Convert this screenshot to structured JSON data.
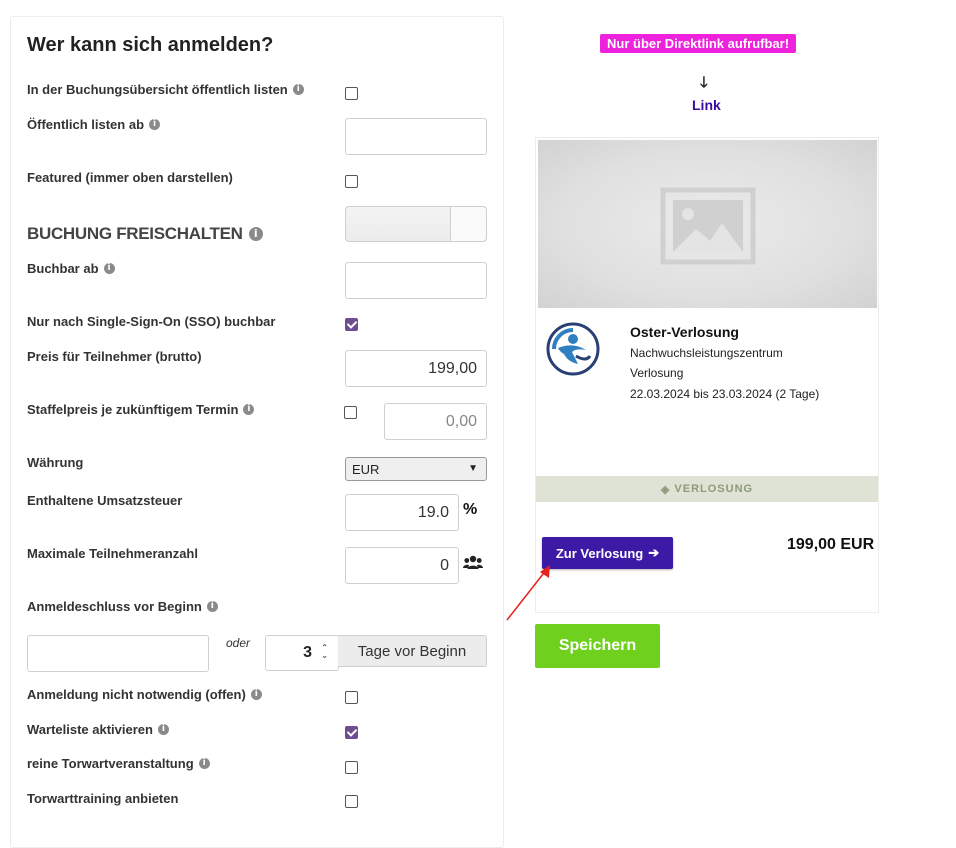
{
  "form": {
    "title": "Wer kann sich anmelden?",
    "list_public_label": "In der Buchungsübersicht öffentlich listen",
    "list_public_from_label": "Öffentlich listen ab",
    "featured_label": "Featured (immer oben darstellen)",
    "section_booking": "BUCHUNG FREISCHALTEN",
    "bookable_from_label": "Buchbar ab",
    "sso_label": "Nur nach Single-Sign-On (SSO) buchbar",
    "price_label": "Preis für Teilnehmer (brutto)",
    "price_value": "199,00",
    "tier_price_label": "Staffelpreis je zukünftigem Termin",
    "tier_price_value": "0,00",
    "currency_label": "Währung",
    "currency_value": "EUR",
    "vat_label": "Enthaltene Umsatzsteuer",
    "vat_value": "19.0",
    "vat_suffix": "%",
    "max_participants_label": "Maximale Teilnehmeranzahl",
    "max_participants_value": "0",
    "deadline_label": "Anmeldeschluss vor Beginn",
    "or_label": "oder",
    "days_value": "3",
    "days_suffix": "Tage vor Beginn",
    "no_registration_label": "Anmeldung nicht notwendig (offen)",
    "waitlist_label": "Warteliste aktivieren",
    "goalkeeper_label": "reine Torwartveranstaltung",
    "goalkeeper_training_label": "Torwarttraining anbieten",
    "info_glyph": "i",
    "checkboxes": {
      "list_public": false,
      "featured": false,
      "sso": true,
      "tier_price": false,
      "no_registration": false,
      "waitlist": true,
      "goalkeeper": false,
      "goalkeeper_training": false
    }
  },
  "preview": {
    "badge": "Nur über Direktlink aufrufbar!",
    "link_label": "Link",
    "down_arrow": "🡓",
    "card_title": "Oster-Verlosung",
    "card_org": "Nachwuchsleistungszentrum",
    "card_type": "Verlosung",
    "card_dates": "22.03.2024 bis 23.03.2024 (2 Tage)",
    "ribbon": "VERLOSUNG",
    "ribbon_icon": "◈",
    "cta_label": "Zur Verlosung",
    "cta_arrow": "➔",
    "price": "199,00 EUR"
  },
  "actions": {
    "save_label": "Speichern"
  },
  "colors": {
    "accent": "#3c1aa6",
    "badge": "#ee22dd",
    "save": "#6fd11e",
    "checkbox_checked": "#6d4c8f"
  }
}
